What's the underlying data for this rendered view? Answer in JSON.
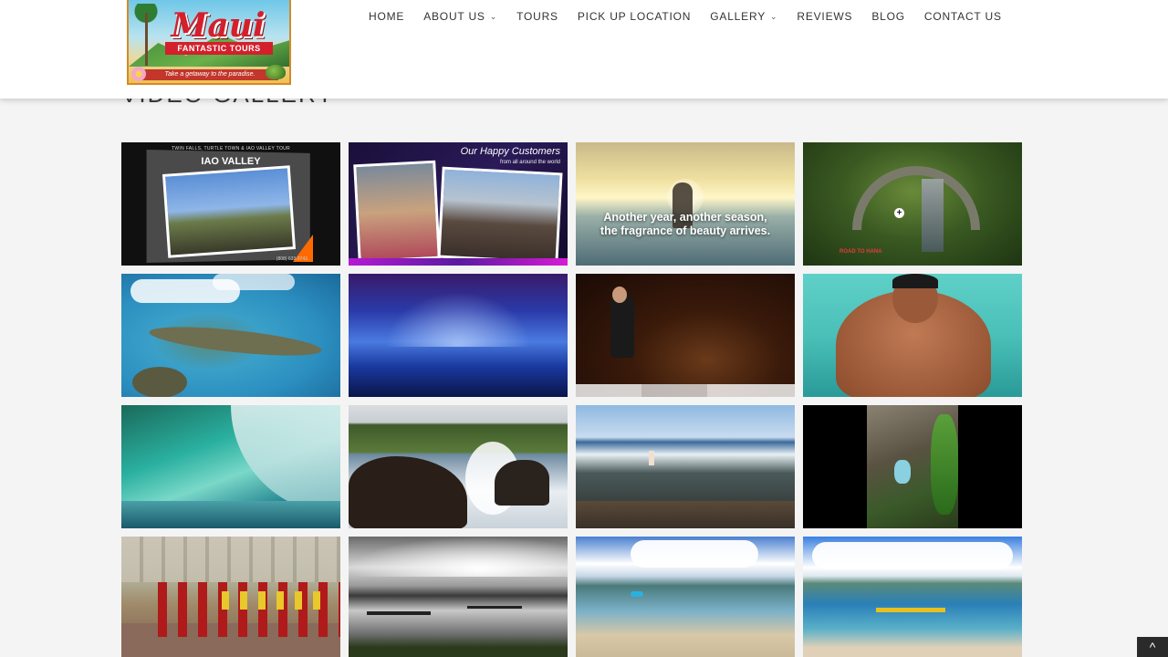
{
  "header": {
    "logo": {
      "brand": "Maui",
      "subtitle": "FANTASTIC TOURS",
      "tagline": "Take a getaway to the paradise."
    },
    "nav": [
      {
        "label": "HOME",
        "has_dropdown": false
      },
      {
        "label": "ABOUT US",
        "has_dropdown": true,
        "icon": "chevron-down-icon"
      },
      {
        "label": "TOURS",
        "has_dropdown": false
      },
      {
        "label": "PICK UP LOCATION",
        "has_dropdown": false
      },
      {
        "label": "GALLERY",
        "has_dropdown": true,
        "icon": "chevron-down-icon"
      },
      {
        "label": "REVIEWS",
        "has_dropdown": false
      },
      {
        "label": "BLOG",
        "has_dropdown": false
      },
      {
        "label": "CONTACT US",
        "has_dropdown": false
      }
    ]
  },
  "page": {
    "section_title": "VIDEO GALLERY"
  },
  "gallery": {
    "videos": [
      {
        "caption_small": "TWIN FALLS, TURTLE TOWN & IAO VALLEY TOUR",
        "caption_big": "IAO VALLEY",
        "phone": "(808) 633-3743"
      },
      {
        "caption_big": "Our Happy Customers",
        "caption_small": "from all around the world"
      },
      {
        "caption_line1": "Another year, another season,",
        "caption_line2": "the fragrance of beauty arrives."
      },
      {
        "label": "ROAD TO HANA",
        "icon": "plus-icon"
      },
      {},
      {},
      {},
      {},
      {},
      {},
      {},
      {},
      {},
      {},
      {},
      {}
    ]
  },
  "scroll_to_top": {
    "icon": "chevron-up-icon",
    "glyph": "^"
  },
  "colors": {
    "header_bg": "#ffffff",
    "page_bg": "#f4f4f4",
    "nav_text": "#333333",
    "logo_red": "#d3202c"
  }
}
